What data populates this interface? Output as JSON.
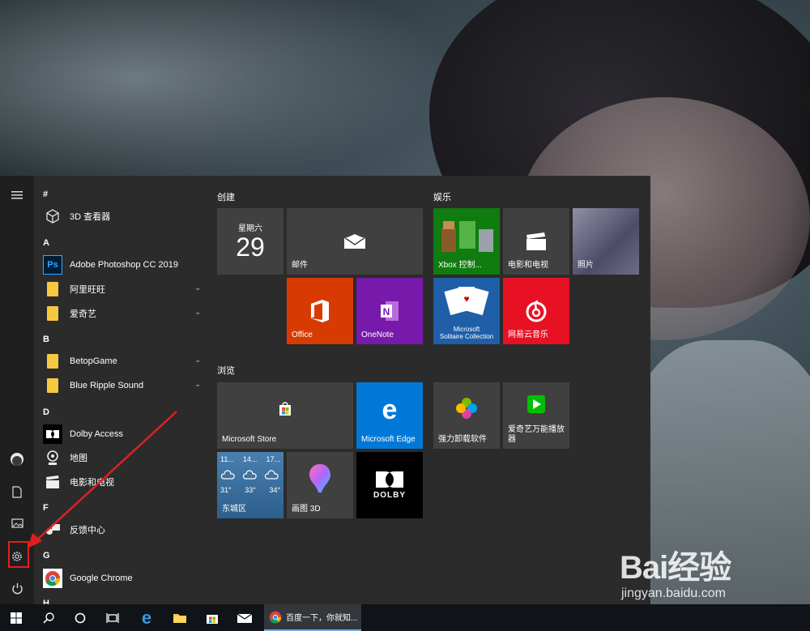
{
  "start_menu": {
    "rail": {
      "menu_icon": "hamburger-icon",
      "user_icon": "user-avatar-icon",
      "documents_icon": "document-icon",
      "pictures_icon": "pictures-icon",
      "settings_icon": "gear-icon",
      "power_icon": "power-icon"
    },
    "app_list": {
      "letters": [
        "#",
        "A",
        "B",
        "D",
        "F",
        "G",
        "H"
      ],
      "apps": [
        {
          "label": "3D 查看器",
          "icon": "cube-icon"
        },
        {
          "label": "Adobe Photoshop CC 2019",
          "icon": "photoshop-icon",
          "badge": "Ps"
        },
        {
          "label": "阿里旺旺",
          "icon": "folder-icon"
        },
        {
          "label": "爱奇艺",
          "icon": "folder-icon"
        },
        {
          "label": "BetopGame",
          "icon": "folder-icon"
        },
        {
          "label": "Blue Ripple Sound",
          "icon": "folder-icon"
        },
        {
          "label": "Dolby Access",
          "icon": "dolby-icon"
        },
        {
          "label": "地图",
          "icon": "map-pin-icon"
        },
        {
          "label": "电影和电视",
          "icon": "clapper-icon"
        },
        {
          "label": "反馈中心",
          "icon": "feedback-icon"
        },
        {
          "label": "Google Chrome",
          "icon": "chrome-icon"
        }
      ]
    },
    "groups": {
      "create": "创建",
      "entertainment": "娱乐",
      "browse": "浏览"
    },
    "tiles": {
      "calendar_day": "星期六",
      "calendar_date": "29",
      "mail": "邮件",
      "office": "Office",
      "onenote": "OneNote",
      "xbox": "Xbox 控制...",
      "movies": "电影和电视",
      "photos": "照片",
      "solitaire_line1": "Microsoft",
      "solitaire_line2": "Solitaire Collection",
      "netease": "网易云音乐",
      "store": "Microsoft Store",
      "edge": "Microsoft Edge",
      "uninstall": "强力卸载软件",
      "iqiyi_line1": "爱奇艺万能播放",
      "iqiyi_line2": "器",
      "paint3d": "画图 3D",
      "dolby": "DOLBY",
      "weather_location": "东城区",
      "weather_times": [
        "11...",
        "14...",
        "17..."
      ],
      "weather_temps": [
        "31°",
        "33°",
        "34°"
      ]
    }
  },
  "taskbar": {
    "start_icon": "windows-icon",
    "search_icon": "search-icon",
    "cortana_icon": "circle-icon",
    "taskview_icon": "task-view-icon",
    "edge_icon": "edge-icon",
    "explorer_icon": "folder-icon",
    "store_icon": "store-icon",
    "mail_icon": "mail-icon",
    "chrome_label": "百度一下，你就知..."
  },
  "watermark": {
    "brand": "Bai经验",
    "url": "jingyan.baidu.com"
  },
  "colors": {
    "highlight": "#e02020",
    "office": "#d83b01",
    "onenote": "#7719aa",
    "xbox": "#107c10",
    "netease": "#e81123",
    "edge": "#0078d7",
    "solitaire": "#1e5fa8"
  }
}
